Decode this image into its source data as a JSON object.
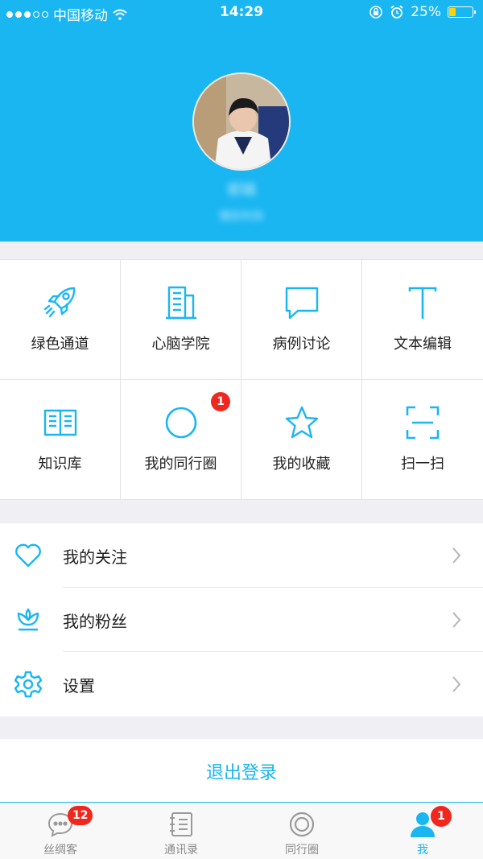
{
  "status_bar": {
    "carrier": "中国移动",
    "time": "14:29",
    "battery": "25%"
  },
  "profile": {
    "name": "郭璐",
    "subtitle": "健民科技"
  },
  "grid": {
    "items": [
      {
        "label": "绿色通道",
        "icon": "rocket-icon"
      },
      {
        "label": "心脑学院",
        "icon": "building-icon"
      },
      {
        "label": "病例讨论",
        "icon": "chat-bubble-icon"
      },
      {
        "label": "文本编辑",
        "icon": "text-icon"
      },
      {
        "label": "知识库",
        "icon": "book-icon"
      },
      {
        "label": "我的同行圈",
        "icon": "circle-icon",
        "badge": "1"
      },
      {
        "label": "我的收藏",
        "icon": "star-icon"
      },
      {
        "label": "扫一扫",
        "icon": "scan-icon"
      }
    ]
  },
  "list": {
    "items": [
      {
        "label": "我的关注",
        "icon": "heart-icon"
      },
      {
        "label": "我的粉丝",
        "icon": "lotus-icon"
      },
      {
        "label": "设置",
        "icon": "gear-icon"
      }
    ]
  },
  "logout": {
    "label": "退出登录"
  },
  "tabbar": {
    "tabs": [
      {
        "label": "丝绸客",
        "icon": "chat-icon",
        "badge": "12"
      },
      {
        "label": "通讯录",
        "icon": "contacts-icon"
      },
      {
        "label": "同行圈",
        "icon": "target-icon"
      },
      {
        "label": "我",
        "icon": "person-icon",
        "badge": "1",
        "active": true
      }
    ]
  },
  "colors": {
    "accent": "#1ab6f2",
    "badge": "#f0271f",
    "background": "#efeff4"
  }
}
